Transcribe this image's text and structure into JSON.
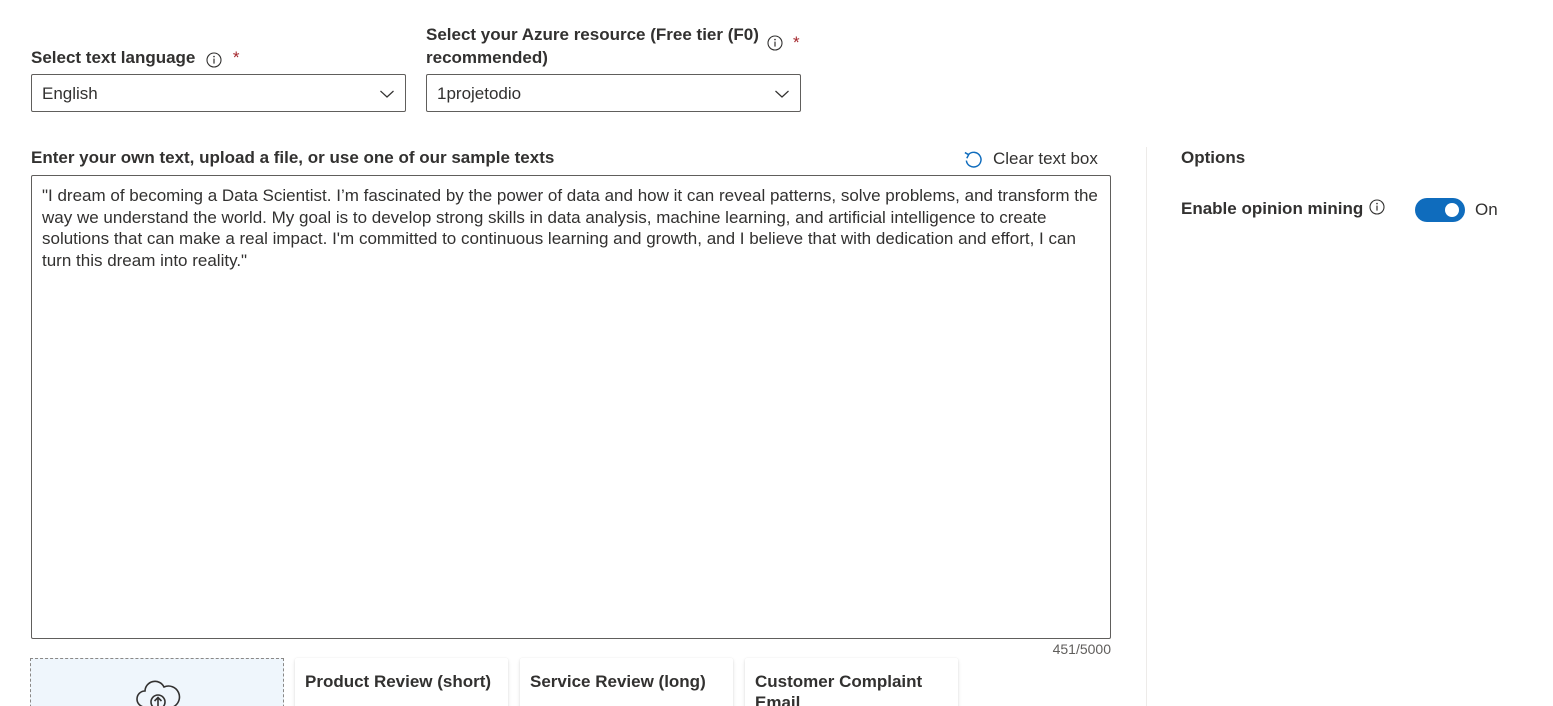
{
  "language": {
    "label": "Select text language",
    "required_mark": "*",
    "selected": "English"
  },
  "resource": {
    "label_line1": "Select your Azure resource (Free tier (F0)",
    "label_line2": "recommended)",
    "required_mark": "*",
    "selected": "1projetodio"
  },
  "input": {
    "label": "Enter your own text, upload a file, or use one of our sample texts",
    "clear_label": "Clear text box",
    "text": "\"I dream of becoming a Data Scientist. I’m fascinated by the power of data and how it can reveal patterns, solve problems, and transform the way we understand the world. My goal is to develop strong skills in data analysis, machine learning, and artificial intelligence to create solutions that can make a real impact. I'm committed to continuous learning and growth, and I believe that with dedication and effort, I can turn this dream into reality.\"",
    "char_count": "451/5000"
  },
  "options": {
    "title": "Options",
    "opinion_mining_label": "Enable opinion mining",
    "opinion_mining_state": "On",
    "opinion_mining_enabled": true
  },
  "samples": [
    {
      "title": "Product Review (short)"
    },
    {
      "title": "Service Review (long)"
    },
    {
      "title": "Customer Complaint Email"
    }
  ],
  "icons": {
    "info": "info-icon",
    "chevron": "chevron-down-icon",
    "clear": "undo-icon",
    "upload": "cloud-upload-icon"
  },
  "colors": {
    "accent": "#0f6cbd",
    "required": "#a4262c",
    "border": "#605e5c"
  }
}
